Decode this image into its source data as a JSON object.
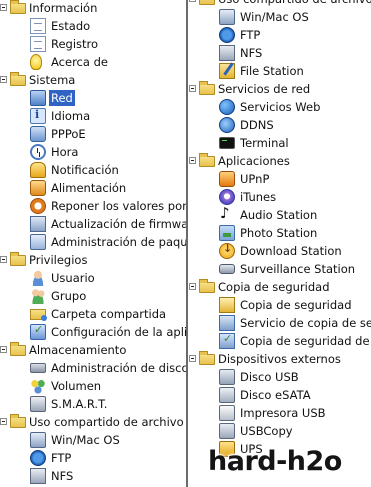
{
  "left_tree": [
    {
      "kind": "group",
      "icon": "folder-icon",
      "label": "Información"
    },
    {
      "kind": "child",
      "icon": "status-icon",
      "label": "Estado"
    },
    {
      "kind": "child",
      "icon": "register-icon",
      "label": "Registro"
    },
    {
      "kind": "child",
      "icon": "about-icon",
      "label": "Acerca de"
    },
    {
      "kind": "group",
      "icon": "folder-icon",
      "label": "Sistema"
    },
    {
      "kind": "child",
      "icon": "network-icon",
      "label": "Red",
      "selected": true
    },
    {
      "kind": "child",
      "icon": "language-icon",
      "label": "Idioma"
    },
    {
      "kind": "child",
      "icon": "pppoe-icon",
      "label": "PPPoE"
    },
    {
      "kind": "child",
      "icon": "clock-icon",
      "label": "Hora"
    },
    {
      "kind": "child",
      "icon": "notification-icon",
      "label": "Notificación"
    },
    {
      "kind": "child",
      "icon": "power-icon",
      "label": "Alimentación"
    },
    {
      "kind": "child",
      "icon": "reset-icon",
      "label": "Reponer los valores por"
    },
    {
      "kind": "child",
      "icon": "firmware-update-icon",
      "label": "Actualización de firmware"
    },
    {
      "kind": "child",
      "icon": "package-admin-icon",
      "label": "Administración de paque"
    },
    {
      "kind": "group",
      "icon": "folder-icon",
      "label": "Privilegios"
    },
    {
      "kind": "child",
      "icon": "user-icon",
      "label": "Usuario"
    },
    {
      "kind": "child",
      "icon": "group-icon",
      "label": "Grupo"
    },
    {
      "kind": "child",
      "icon": "shared-folder-icon",
      "label": "Carpeta compartida"
    },
    {
      "kind": "child",
      "icon": "config-icon",
      "label": "Configuración de la aplic"
    },
    {
      "kind": "group",
      "icon": "folder-icon",
      "label": "Almacenamiento"
    },
    {
      "kind": "child",
      "icon": "disk-admin-icon",
      "label": "Administración de disco"
    },
    {
      "kind": "child",
      "icon": "volume-icon",
      "label": "Volumen"
    },
    {
      "kind": "child",
      "icon": "smart-icon",
      "label": "S.M.A.R.T."
    },
    {
      "kind": "group",
      "icon": "folder-icon",
      "label": "Uso compartido de archivo"
    },
    {
      "kind": "child",
      "icon": "winmac-icon",
      "label": "Win/Mac OS"
    },
    {
      "kind": "child",
      "icon": "ftp-icon",
      "label": "FTP"
    },
    {
      "kind": "child",
      "icon": "nfs-icon",
      "label": "NFS"
    }
  ],
  "right_tree": [
    {
      "kind": "group",
      "icon": "folder-icon",
      "label": "Uso compartido de archivo"
    },
    {
      "kind": "child",
      "icon": "winmac-icon",
      "label": "Win/Mac OS"
    },
    {
      "kind": "child",
      "icon": "ftp-icon",
      "label": "FTP"
    },
    {
      "kind": "child",
      "icon": "nfs-icon",
      "label": "NFS"
    },
    {
      "kind": "child",
      "icon": "file-station-icon",
      "label": "File Station"
    },
    {
      "kind": "group",
      "icon": "folder-icon",
      "label": "Servicios de red"
    },
    {
      "kind": "child",
      "icon": "web-services-icon",
      "label": "Servicios Web"
    },
    {
      "kind": "child",
      "icon": "ddns-icon",
      "label": "DDNS"
    },
    {
      "kind": "child",
      "icon": "terminal-icon",
      "label": "Terminal"
    },
    {
      "kind": "group",
      "icon": "folder-icon",
      "label": "Aplicaciones"
    },
    {
      "kind": "child",
      "icon": "upnp-icon",
      "label": "UPnP"
    },
    {
      "kind": "child",
      "icon": "itunes-icon",
      "label": "iTunes"
    },
    {
      "kind": "child",
      "icon": "audio-station-icon",
      "label": "Audio Station"
    },
    {
      "kind": "child",
      "icon": "photo-station-icon",
      "label": "Photo Station"
    },
    {
      "kind": "child",
      "icon": "download-station-icon",
      "label": "Download Station"
    },
    {
      "kind": "child",
      "icon": "surveillance-station-icon",
      "label": "Surveillance Station"
    },
    {
      "kind": "group",
      "icon": "folder-icon",
      "label": "Copia de seguridad"
    },
    {
      "kind": "child",
      "icon": "backup-icon",
      "label": "Copia de seguridad"
    },
    {
      "kind": "child",
      "icon": "backup-service-icon",
      "label": "Servicio de copia de segu"
    },
    {
      "kind": "child",
      "icon": "backup-check-icon",
      "label": "Copia de seguridad de c"
    },
    {
      "kind": "group",
      "icon": "folder-icon",
      "label": "Dispositivos externos"
    },
    {
      "kind": "child",
      "icon": "usb-disk-icon",
      "label": "Disco USB"
    },
    {
      "kind": "child",
      "icon": "esata-disk-icon",
      "label": "Disco eSATA"
    },
    {
      "kind": "child",
      "icon": "printer-icon",
      "label": "Impresora USB"
    },
    {
      "kind": "child",
      "icon": "usbcopy-icon",
      "label": "USBCopy"
    },
    {
      "kind": "child",
      "icon": "ups-icon",
      "label": "UPS"
    }
  ],
  "watermark": "hard-h2o",
  "colors": {
    "selection": "#2f64c4",
    "divider": "#6a6a6a"
  }
}
